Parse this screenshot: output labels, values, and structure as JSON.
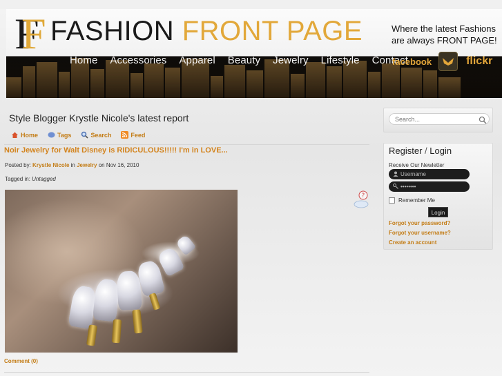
{
  "header": {
    "logo_word1": "FASHION",
    "logo_word2": "FRONT PAGE",
    "tagline_line1": "Where the latest Fashions",
    "tagline_line2": "are always FRONT PAGE!",
    "nav": [
      "Home",
      "Accessories",
      "Apparel",
      "Beauty",
      "Jewelry",
      "Lifestyle",
      "Contact"
    ],
    "facebook_label": "facebook",
    "flickr_label": "flickr"
  },
  "main": {
    "page_title": "Style Blogger Krystle Nicole's latest report",
    "subnav": {
      "home": "Home",
      "tags": "Tags",
      "search": "Search",
      "feed": "Feed"
    },
    "article": {
      "title": "Noir Jewelry for Walt Disney is RIDICULOUS!!!!! I'm in LOVE...",
      "posted_by_label": "Posted by:",
      "author": "Krystle Nicole",
      "in_label": "in",
      "category": "Jewelry",
      "date": "on Nov 16, 2010",
      "tagged_label": "Tagged in:",
      "tag": "Untagged",
      "comment_link": "Comment (0)"
    }
  },
  "sidebar": {
    "search_placeholder": "Search...",
    "login": {
      "title_register": "Register",
      "title_sep": "/",
      "title_login": "Login",
      "newsletter": "Receive Our Newletter",
      "username_placeholder": "Username",
      "password_value": "••••••••",
      "remember_me": "Remember Me",
      "login_button": "Login",
      "forgot_password": "Forgot your password?",
      "forgot_username": "Forgot your username?",
      "create_account": "Create an account"
    }
  },
  "colors": {
    "accent": "#c37c15",
    "title_link": "#d3831c",
    "logo_gold": "#e2a83a"
  }
}
